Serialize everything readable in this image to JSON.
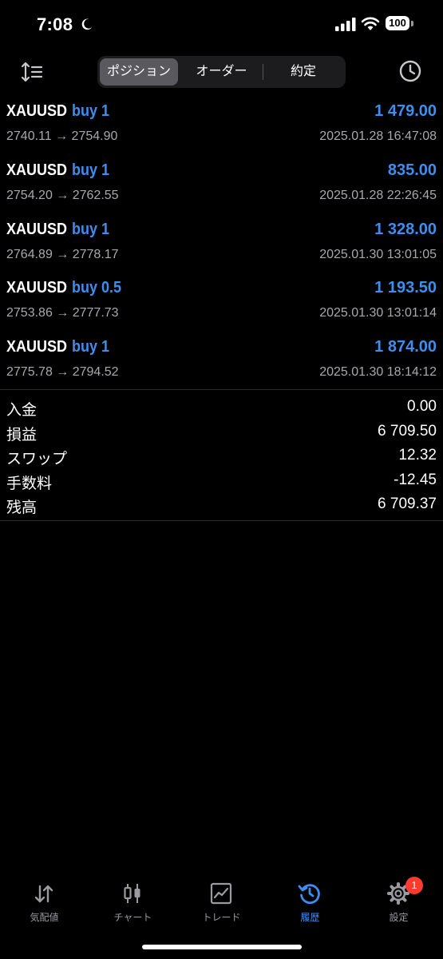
{
  "status_bar": {
    "time": "7:08",
    "battery": "100"
  },
  "toolbar": {
    "tabs": [
      {
        "label": "ポジション",
        "active": true
      },
      {
        "label": "オーダー",
        "active": false
      },
      {
        "label": "約定",
        "active": false
      }
    ]
  },
  "deals": [
    {
      "symbol": "XAUUSD",
      "type": "buy 1",
      "profit": "1 479.00",
      "prices": "2740.11 → 2754.90",
      "time": "2025.01.28 16:47:08"
    },
    {
      "symbol": "XAUUSD",
      "type": "buy 1",
      "profit": "835.00",
      "prices": "2754.20 → 2762.55",
      "time": "2025.01.28 22:26:45"
    },
    {
      "symbol": "XAUUSD",
      "type": "buy 1",
      "profit": "1 328.00",
      "prices": "2764.89 → 2778.17",
      "time": "2025.01.30 13:01:05"
    },
    {
      "symbol": "XAUUSD",
      "type": "buy 0.5",
      "profit": "1 193.50",
      "prices": "2753.86 → 2777.73",
      "time": "2025.01.30 13:01:14"
    },
    {
      "symbol": "XAUUSD",
      "type": "buy 1",
      "profit": "1 874.00",
      "prices": "2775.78 → 2794.52",
      "time": "2025.01.30 18:14:12"
    }
  ],
  "summary": [
    {
      "label": "入金",
      "value": "0.00"
    },
    {
      "label": "損益",
      "value": "6 709.50"
    },
    {
      "label": "スワップ",
      "value": "12.32"
    },
    {
      "label": "手数料",
      "value": "-12.45"
    },
    {
      "label": "残高",
      "value": "6 709.37"
    }
  ],
  "tabbar": {
    "items": [
      {
        "label": "気配値",
        "icon": "quotes-arrows-icon"
      },
      {
        "label": "チャート",
        "icon": "chart-candles-icon"
      },
      {
        "label": "トレード",
        "icon": "trade-chart-icon"
      },
      {
        "label": "履歴",
        "icon": "history-icon",
        "active": true
      },
      {
        "label": "設定",
        "icon": "settings-gear-icon",
        "badge": "1"
      }
    ]
  },
  "colors": {
    "accent": "#3d8ef0",
    "muted_text": "#a8a8ad",
    "background": "#000000",
    "badge": "#ff3b30"
  }
}
